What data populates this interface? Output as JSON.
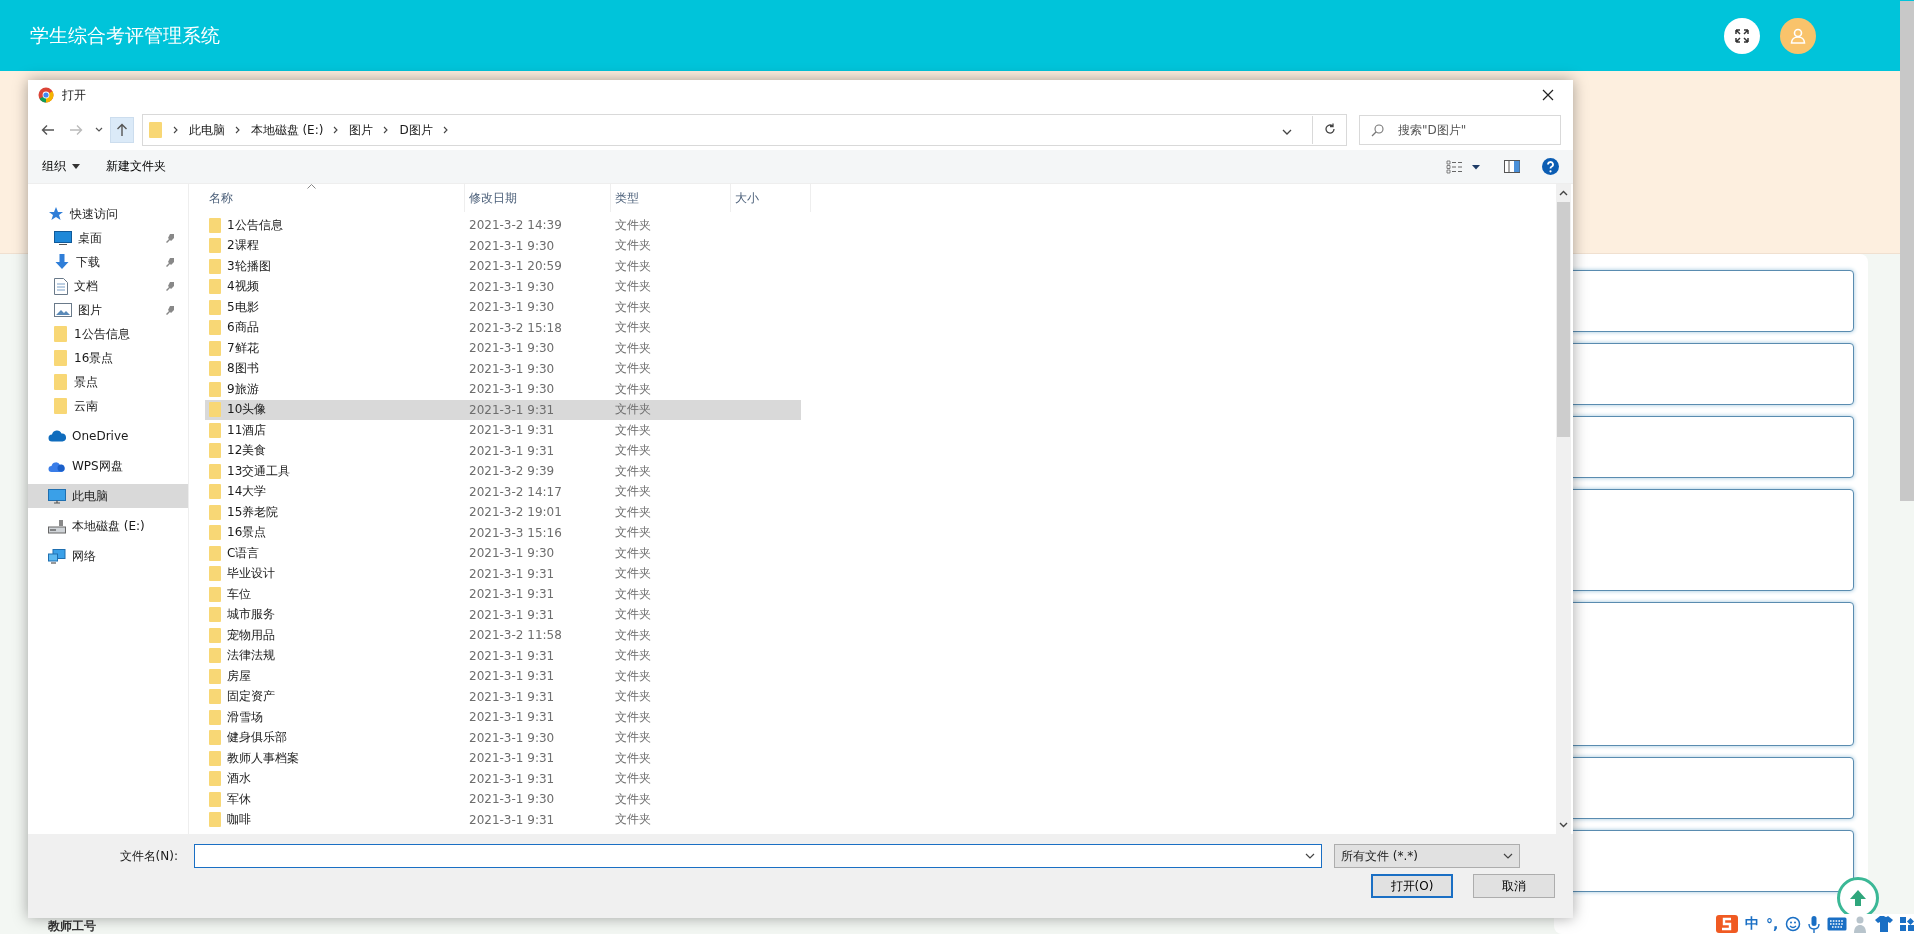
{
  "app": {
    "title": "学生综合考评管理系统",
    "form_label": "教师工号"
  },
  "dialog": {
    "title": "打开",
    "breadcrumb": [
      "此电脑",
      "本地磁盘 (E:)",
      "图片",
      "D图片"
    ],
    "search": {
      "placeholder": "搜索\"D图片\""
    },
    "organize": "组织",
    "new_folder": "新建文件夹",
    "sidebar": [
      {
        "kind": "quick",
        "label": "快速访问",
        "selected": false,
        "children": [
          {
            "kind": "desktop",
            "label": "桌面",
            "pinned": true,
            "selected": false
          },
          {
            "kind": "download",
            "label": "下载",
            "pinned": true,
            "selected": false
          },
          {
            "kind": "document",
            "label": "文档",
            "pinned": true,
            "selected": false
          },
          {
            "kind": "picture",
            "label": "图片",
            "pinned": true,
            "selected": false
          },
          {
            "kind": "folder",
            "label": "1公告信息",
            "pinned": false,
            "selected": false
          },
          {
            "kind": "folder",
            "label": "16景点",
            "pinned": false,
            "selected": false
          },
          {
            "kind": "folder",
            "label": "景点",
            "pinned": false,
            "selected": false
          },
          {
            "kind": "folder",
            "label": "云南",
            "pinned": false,
            "selected": false
          }
        ]
      },
      {
        "kind": "onedrive",
        "label": "OneDrive",
        "selected": false
      },
      {
        "kind": "wps",
        "label": "WPS网盘",
        "selected": false
      },
      {
        "kind": "pc",
        "label": "此电脑",
        "selected": true
      },
      {
        "kind": "drive",
        "label": "本地磁盘 (E:)",
        "selected": false
      },
      {
        "kind": "network",
        "label": "网络",
        "selected": false
      }
    ],
    "columns": [
      "名称",
      "修改日期",
      "类型",
      "大小"
    ],
    "files": [
      {
        "name": "1公告信息",
        "date": "2021-3-2 14:39",
        "type": "文件夹",
        "selected": false
      },
      {
        "name": "2课程",
        "date": "2021-3-1 9:30",
        "type": "文件夹",
        "selected": false
      },
      {
        "name": "3轮播图",
        "date": "2021-3-1 20:59",
        "type": "文件夹",
        "selected": false
      },
      {
        "name": "4视频",
        "date": "2021-3-1 9:30",
        "type": "文件夹",
        "selected": false
      },
      {
        "name": "5电影",
        "date": "2021-3-1 9:30",
        "type": "文件夹",
        "selected": false
      },
      {
        "name": "6商品",
        "date": "2021-3-2 15:18",
        "type": "文件夹",
        "selected": false
      },
      {
        "name": "7鲜花",
        "date": "2021-3-1 9:30",
        "type": "文件夹",
        "selected": false
      },
      {
        "name": "8图书",
        "date": "2021-3-1 9:30",
        "type": "文件夹",
        "selected": false
      },
      {
        "name": "9旅游",
        "date": "2021-3-1 9:30",
        "type": "文件夹",
        "selected": false
      },
      {
        "name": "10头像",
        "date": "2021-3-1 9:31",
        "type": "文件夹",
        "selected": true
      },
      {
        "name": "11酒店",
        "date": "2021-3-1 9:31",
        "type": "文件夹",
        "selected": false
      },
      {
        "name": "12美食",
        "date": "2021-3-1 9:31",
        "type": "文件夹",
        "selected": false
      },
      {
        "name": "13交通工具",
        "date": "2021-3-2 9:39",
        "type": "文件夹",
        "selected": false
      },
      {
        "name": "14大学",
        "date": "2021-3-2 14:17",
        "type": "文件夹",
        "selected": false
      },
      {
        "name": "15养老院",
        "date": "2021-3-2 19:01",
        "type": "文件夹",
        "selected": false
      },
      {
        "name": "16景点",
        "date": "2021-3-3 15:16",
        "type": "文件夹",
        "selected": false
      },
      {
        "name": "C语言",
        "date": "2021-3-1 9:30",
        "type": "文件夹",
        "selected": false
      },
      {
        "name": "毕业设计",
        "date": "2021-3-1 9:31",
        "type": "文件夹",
        "selected": false
      },
      {
        "name": "车位",
        "date": "2021-3-1 9:31",
        "type": "文件夹",
        "selected": false
      },
      {
        "name": "城市服务",
        "date": "2021-3-1 9:31",
        "type": "文件夹",
        "selected": false
      },
      {
        "name": "宠物用品",
        "date": "2021-3-2 11:58",
        "type": "文件夹",
        "selected": false
      },
      {
        "name": "法律法规",
        "date": "2021-3-1 9:31",
        "type": "文件夹",
        "selected": false
      },
      {
        "name": "房屋",
        "date": "2021-3-1 9:31",
        "type": "文件夹",
        "selected": false
      },
      {
        "name": "固定资产",
        "date": "2021-3-1 9:31",
        "type": "文件夹",
        "selected": false
      },
      {
        "name": "滑雪场",
        "date": "2021-3-1 9:31",
        "type": "文件夹",
        "selected": false
      },
      {
        "name": "健身俱乐部",
        "date": "2021-3-1 9:30",
        "type": "文件夹",
        "selected": false
      },
      {
        "name": "教师人事档案",
        "date": "2021-3-1 9:31",
        "type": "文件夹",
        "selected": false
      },
      {
        "name": "酒水",
        "date": "2021-3-1 9:31",
        "type": "文件夹",
        "selected": false
      },
      {
        "name": "军休",
        "date": "2021-3-1 9:30",
        "type": "文件夹",
        "selected": false
      },
      {
        "name": "咖啡",
        "date": "2021-3-1 9:31",
        "type": "文件夹",
        "selected": false
      }
    ],
    "filename_label": "文件名(N):",
    "filetype": "所有文件 (*.*)",
    "buttons": [
      "打开(O)",
      "取消"
    ]
  },
  "ime": {
    "mode": "中",
    "punct": "°,"
  }
}
